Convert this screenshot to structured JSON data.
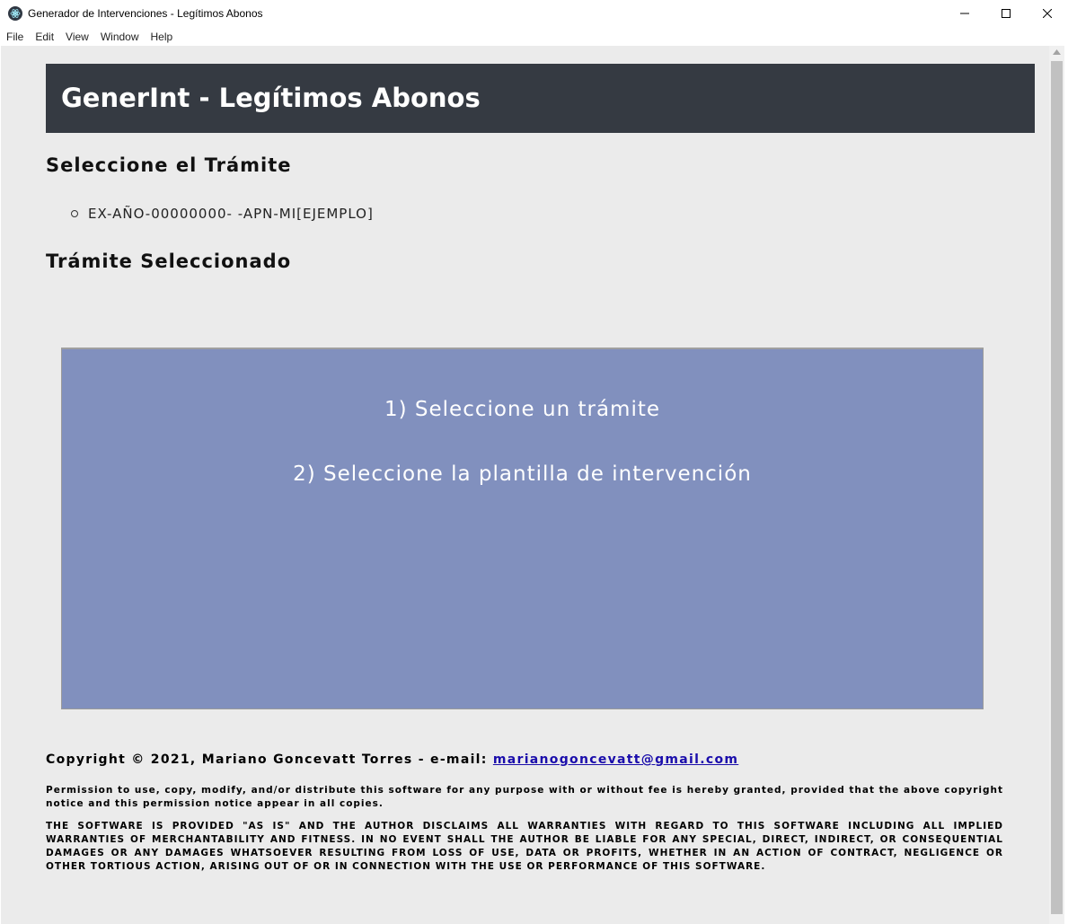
{
  "window": {
    "title": "Generador de Intervenciones - Legítimos Abonos",
    "controls": [
      "minimize-icon",
      "maximize-icon",
      "close-icon"
    ]
  },
  "menu": [
    "File",
    "Edit",
    "View",
    "Window",
    "Help"
  ],
  "header": {
    "title": "GenerInt - Legítimos Abonos"
  },
  "select_section": {
    "title": "Seleccione el Trámite",
    "items": [
      "EX-AÑO-00000000- -APN-MI[EJEMPLO]"
    ]
  },
  "selected_section": {
    "title": "Trámite Seleccionado"
  },
  "panel": {
    "line1": "1) Seleccione un trámite",
    "line2": "2) Seleccione la plantilla de intervención",
    "background": "#8190be"
  },
  "footer": {
    "copyright_prefix": "Copyright © 2021, Mariano Goncevatt Torres - e-mail:",
    "email": "marianogoncevatt@gmail.com",
    "permission": "Permission to use, copy, modify, and/or distribute this software for any purpose with or without fee is hereby granted, provided that the above copyright notice and this permission notice appear in all copies.",
    "disclaimer": "THE SOFTWARE IS PROVIDED \"AS IS\" AND THE AUTHOR DISCLAIMS ALL WARRANTIES WITH REGARD TO THIS SOFTWARE INCLUDING ALL IMPLIED WARRANTIES OF MERCHANTABILITY AND FITNESS. IN NO EVENT SHALL THE AUTHOR BE LIABLE FOR ANY SPECIAL, DIRECT, INDIRECT, OR CONSEQUENTIAL DAMAGES OR ANY DAMAGES WHATSOEVER RESULTING FROM LOSS OF USE, DATA OR PROFITS, WHETHER IN AN ACTION OF CONTRACT, NEGLIGENCE OR OTHER TORTIOUS ACTION, ARISING OUT OF OR IN CONNECTION WITH THE USE OR PERFORMANCE OF THIS SOFTWARE."
  },
  "colors": {
    "header_bg": "#353a42",
    "content_bg": "#ebebeb",
    "link": "#1a0dab"
  }
}
